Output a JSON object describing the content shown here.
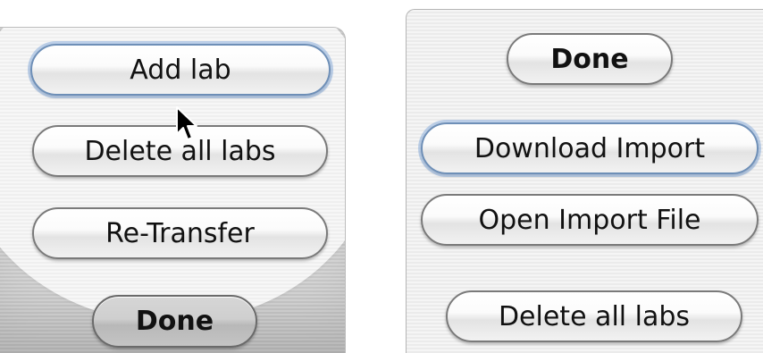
{
  "left_panel": {
    "buttons": {
      "add_lab": "Add lab",
      "delete_all_labs": "Delete all labs",
      "re_transfer": "Re-Transfer",
      "done": "Done"
    }
  },
  "right_panel": {
    "buttons": {
      "done": "Done",
      "download_import": "Download Import",
      "open_import_file": "Open Import File",
      "delete_all_labs": "Delete all labs"
    }
  },
  "cursor": {
    "icon": "arrow-pointer-icon"
  }
}
